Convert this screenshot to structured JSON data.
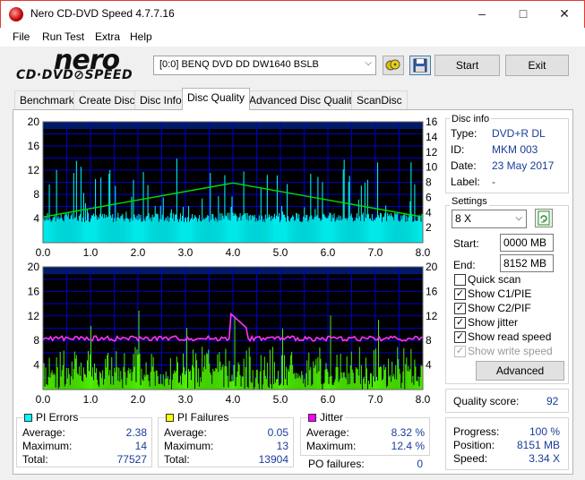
{
  "window": {
    "title": "Nero CD-DVD Speed 4.7.7.16"
  },
  "menu": [
    "File",
    "Run Test",
    "Extra",
    "Help"
  ],
  "logo": {
    "main": "nero",
    "sub": "CD·DVD⊘SPEED"
  },
  "drive": {
    "value": "[0:0]  BENQ DVD DD DW1640 BSLB"
  },
  "buttons": {
    "start": "Start",
    "exit": "Exit",
    "advanced": "Advanced"
  },
  "tabs": [
    "Benchmark",
    "Create Disc",
    "Disc Info",
    "Disc Quality",
    "Advanced Disc Quality",
    "ScanDisc"
  ],
  "active_tab": "Disc Quality",
  "disc_info": {
    "title": "Disc info",
    "rows": [
      {
        "label": "Type:",
        "value": "DVD+R DL"
      },
      {
        "label": "ID:",
        "value": "MKM 003"
      },
      {
        "label": "Date:",
        "value": "23 May 2017"
      },
      {
        "label": "Label:",
        "value": "-"
      }
    ]
  },
  "settings": {
    "title": "Settings",
    "speed": "8 X",
    "start_label": "Start:",
    "start_value": "0000 MB",
    "end_label": "End:",
    "end_value": "8152 MB",
    "checks": [
      {
        "label": "Quick scan",
        "checked": false,
        "enabled": true
      },
      {
        "label": "Show C1/PIE",
        "checked": true,
        "enabled": true
      },
      {
        "label": "Show C2/PIF",
        "checked": true,
        "enabled": true
      },
      {
        "label": "Show jitter",
        "checked": true,
        "enabled": true
      },
      {
        "label": "Show read speed",
        "checked": true,
        "enabled": true
      },
      {
        "label": "Show write speed",
        "checked": true,
        "enabled": false
      }
    ]
  },
  "quality": {
    "label": "Quality score:",
    "value": "92"
  },
  "progress": [
    {
      "label": "Progress:",
      "value": "100 %"
    },
    {
      "label": "Position:",
      "value": "8151 MB"
    },
    {
      "label": "Speed:",
      "value": "3.34 X"
    }
  ],
  "stats": {
    "pi_errors": {
      "title": "PI Errors",
      "color": "#00ffff",
      "rows": [
        {
          "label": "Average:",
          "value": "2.38"
        },
        {
          "label": "Maximum:",
          "value": "14"
        },
        {
          "label": "Total:",
          "value": "77527"
        }
      ]
    },
    "pi_failures": {
      "title": "PI Failures",
      "color": "#ffff00",
      "rows": [
        {
          "label": "Average:",
          "value": "0.05"
        },
        {
          "label": "Maximum:",
          "value": "13"
        },
        {
          "label": "Total:",
          "value": "13904"
        }
      ]
    },
    "jitter": {
      "title": "Jitter",
      "color": "#ff00ff",
      "rows": [
        {
          "label": "Average:",
          "value": "8.32 %"
        },
        {
          "label": "Maximum:",
          "value": "12.4 %"
        }
      ],
      "po_label": "PO failures:",
      "po_value": "0"
    }
  },
  "chart_data": [
    {
      "type": "bar",
      "name": "PI Errors / read speed",
      "x_ticks": [
        "0.0",
        "1.0",
        "2.0",
        "3.0",
        "4.0",
        "5.0",
        "6.0",
        "7.0",
        "8.0"
      ],
      "y_left_ticks": [
        "20",
        "16",
        "12",
        "8",
        "4"
      ],
      "y_right_ticks": [
        "16",
        "14",
        "12",
        "10",
        "8",
        "6",
        "4",
        "2"
      ],
      "xlim": [
        0,
        8
      ],
      "ylim": [
        0,
        20
      ],
      "grid": true,
      "pi_errors_avg": 2.38,
      "pi_errors_max": 14,
      "read_speed_profile": {
        "x": [
          0,
          4.0,
          8.0
        ],
        "y": [
          3.4,
          7.9,
          3.4
        ]
      }
    },
    {
      "type": "bar",
      "name": "PI Failures / jitter",
      "x_ticks": [
        "0.0",
        "1.0",
        "2.0",
        "3.0",
        "4.0",
        "5.0",
        "6.0",
        "7.0",
        "8.0"
      ],
      "y_left_ticks": [
        "20",
        "16",
        "12",
        "8",
        "4"
      ],
      "y_right_ticks": [
        "20",
        "16",
        "12",
        "8",
        "4"
      ],
      "xlim": [
        0,
        8
      ],
      "ylim": [
        0,
        20
      ],
      "grid": true,
      "pi_failures_max": 13,
      "jitter_avg": 8.32,
      "jitter_max": 12.4
    }
  ]
}
